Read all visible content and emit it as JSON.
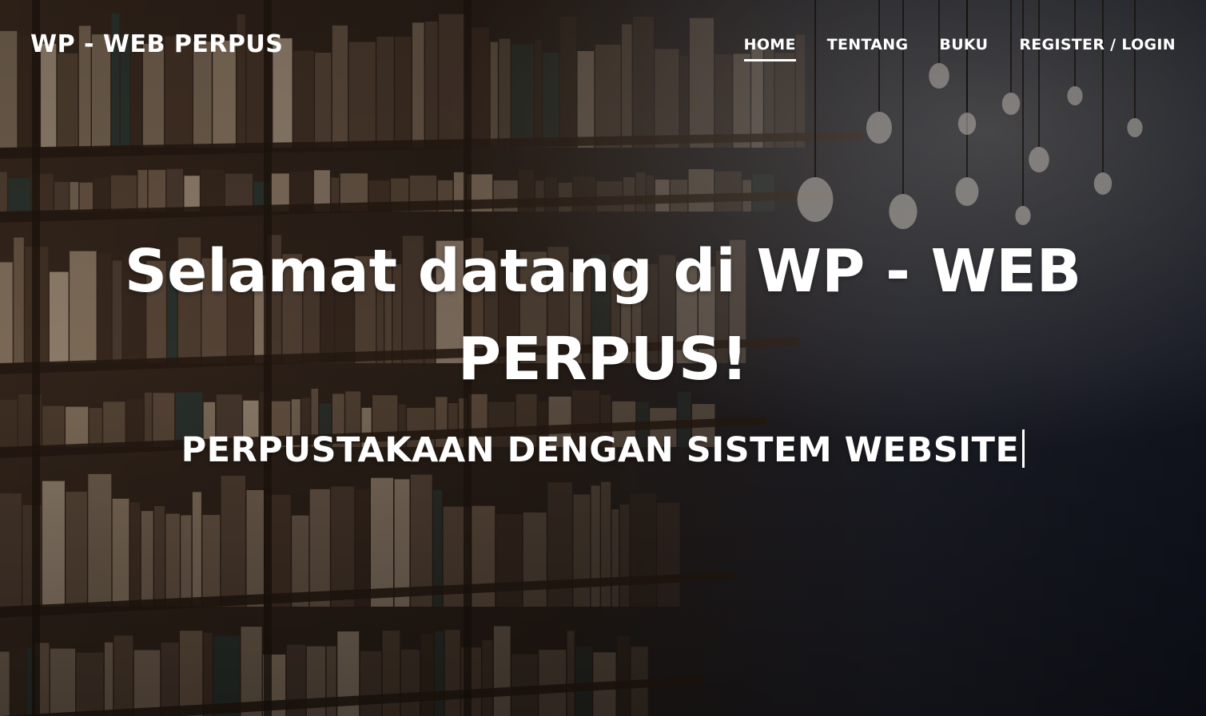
{
  "navbar": {
    "brand": "WP - WEB PERPUS",
    "items": [
      {
        "label": "HOME",
        "active": true
      },
      {
        "label": "TENTANG",
        "active": false
      },
      {
        "label": "BUKU",
        "active": false
      },
      {
        "label": "REGISTER / LOGIN",
        "active": false
      }
    ]
  },
  "hero": {
    "title": "Selamat datang di WP - WEB PERPUS!",
    "subtitle": "PERPUSTAKAAN DENGAN SISTEM WEBSITE"
  },
  "colors": {
    "text": "#ffffff",
    "overlay": "#1c1410"
  }
}
